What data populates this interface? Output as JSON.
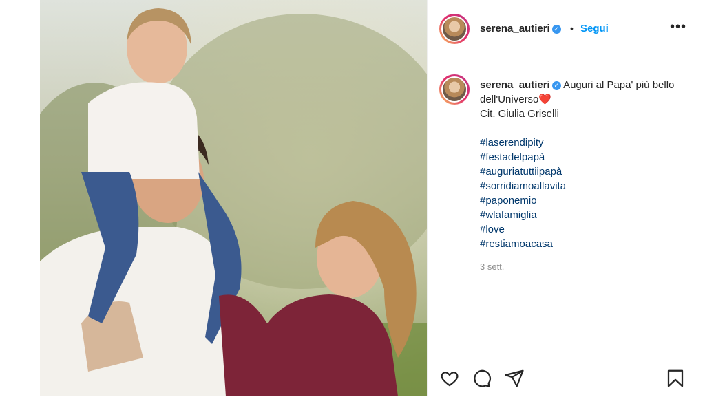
{
  "post": {
    "username": "serena_autieri",
    "follow_separator": "•",
    "follow_label": "Segui",
    "more_label": "•••",
    "verified_glyph": "✓",
    "caption_line1": "Auguri al Papa' più bello dell'Universo",
    "heart": "❤️",
    "caption_line2": "Cit. Giulia Griselli",
    "hashtags": [
      "#laserendipity",
      "#festadelpapà",
      "#auguriatuttiipapà",
      "#sorridiamoallavita",
      "#paponemio",
      "#wlafamiglia",
      "#love",
      "#restiamoacasa"
    ],
    "time_ago": "3 sett."
  },
  "colors": {
    "follow_blue": "#0095f6",
    "hashtag_blue": "#00376b",
    "verified_blue": "#3897f0",
    "muted_gray": "#8e8e8e"
  },
  "icons": {
    "actions": [
      "heart-icon",
      "comment-icon",
      "share-icon",
      "bookmark-icon"
    ]
  }
}
